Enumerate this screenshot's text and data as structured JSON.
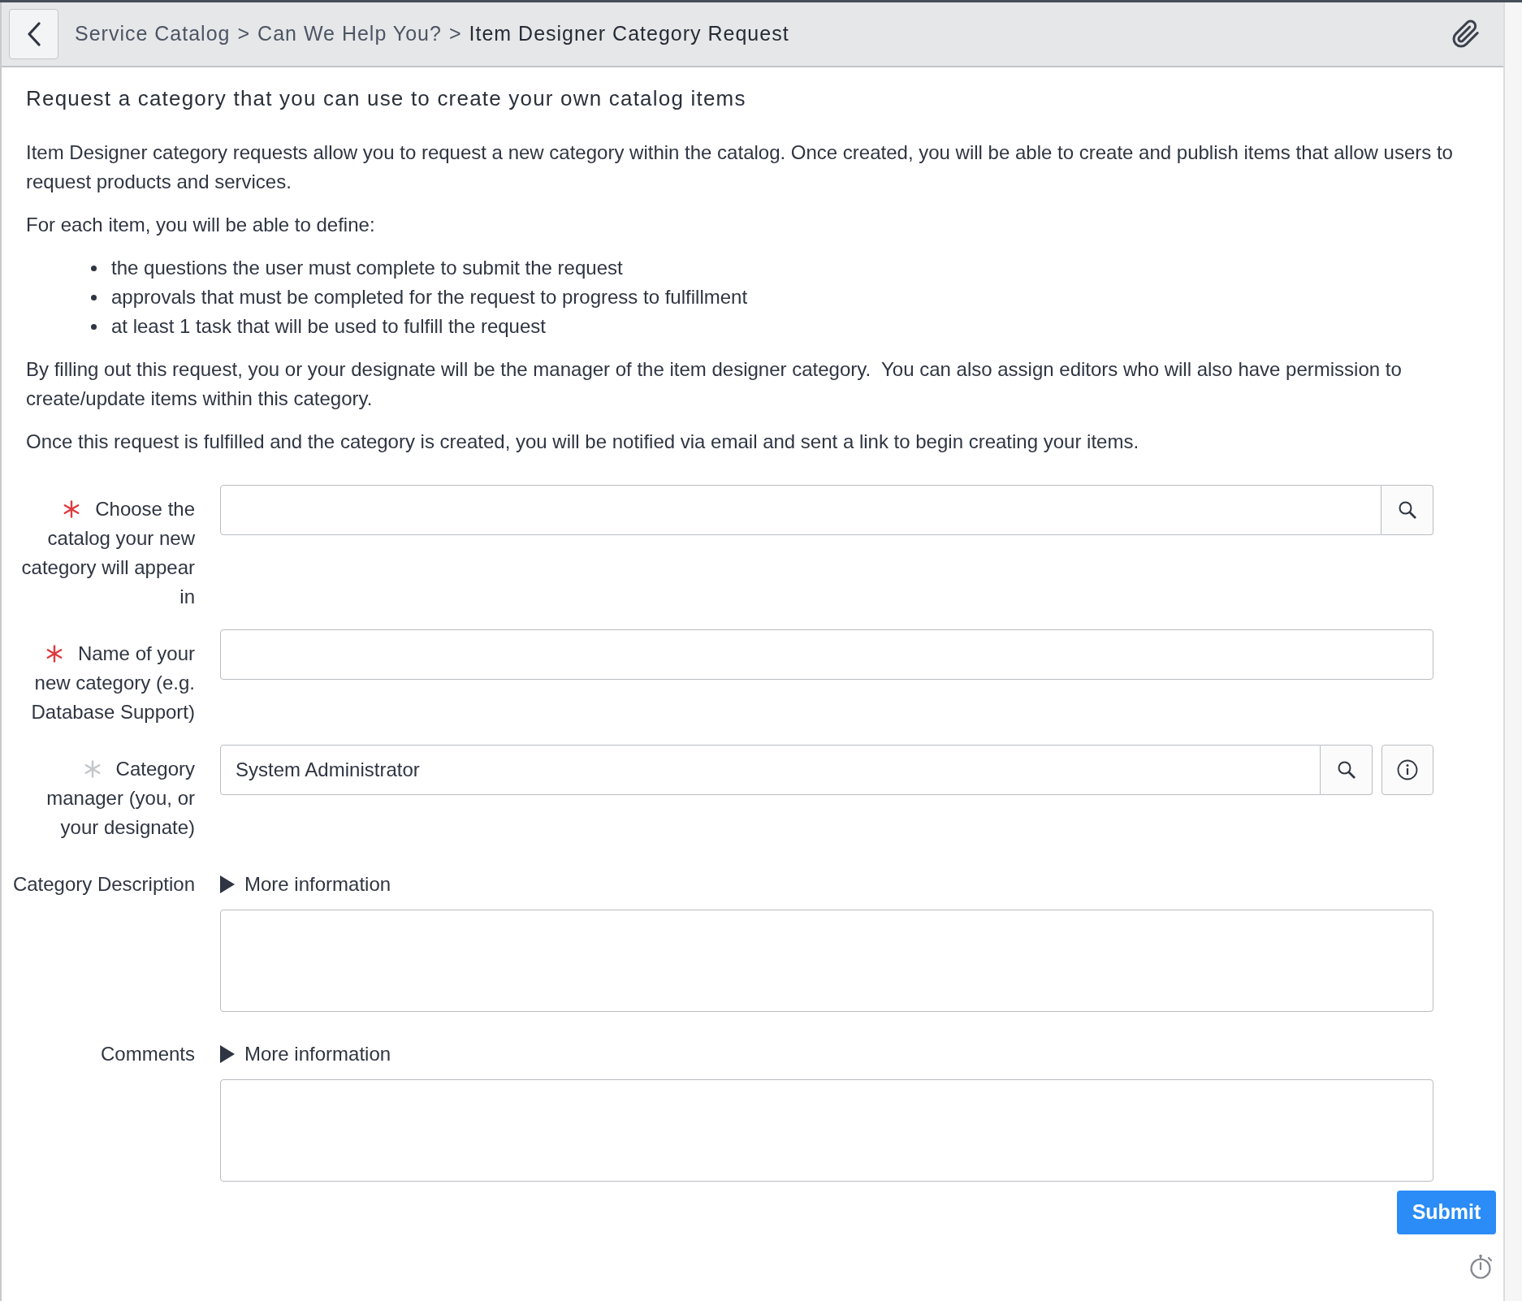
{
  "header": {
    "breadcrumbs": [
      {
        "label": "Service Catalog",
        "current": false
      },
      {
        "separator": ">",
        "label": "Can We Help You?",
        "current": false
      },
      {
        "separator": ">",
        "label": "Item Designer Category Request",
        "current": true
      }
    ]
  },
  "description": {
    "heading": "Request a category that you can use to create your own catalog items",
    "blocks": [
      {
        "kind": "paragraph",
        "text": "Item Designer category requests allow you to request a new category within the catalog. Once created, you will be able to create and publish items that allow users to request products and services."
      },
      {
        "kind": "paragraph",
        "text": "For each item, you will be able to define:"
      },
      {
        "kind": "list",
        "items": [
          "the questions the user must complete to submit the request",
          "approvals that must be completed for the request to progress to fulfillment",
          "at least 1 task that will be used to fulfill the request"
        ]
      },
      {
        "kind": "paragraph",
        "text": "By filling out this request, you or your designate will be the manager of the item designer category.  You can also assign editors who will also have permission to create/update items within this category."
      },
      {
        "kind": "paragraph",
        "text": "Once this request is fulfilled and the category is created, you will be notified via email and sent a link to begin creating your items."
      }
    ]
  },
  "form": {
    "fields": [
      {
        "kind": "lookup",
        "label": "Choose the catalog your new category will appear in",
        "mandatory": true,
        "satisfied": false,
        "info_button": false
      },
      {
        "kind": "text",
        "label": "Name of your new category (e.g. Database Support)",
        "mandatory": true,
        "satisfied": false
      },
      {
        "kind": "lookup",
        "label": "Category manager (you, or your designate)",
        "mandatory": true,
        "satisfied": true,
        "value": "System Administrator",
        "info_button": true
      },
      {
        "kind": "textarea",
        "label": "Category Description",
        "mandatory": false,
        "help": {
          "label": "More information",
          "expanded": false
        }
      },
      {
        "kind": "textarea",
        "label": "Comments",
        "mandatory": false,
        "help": {
          "label": "More information",
          "expanded": false
        }
      }
    ],
    "submit": "Submit"
  }
}
